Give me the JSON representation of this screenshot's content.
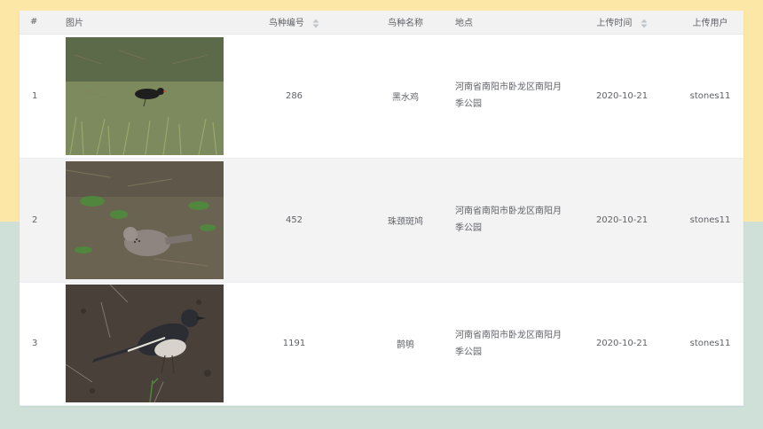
{
  "table": {
    "headers": {
      "index": "#",
      "image": "图片",
      "species_id": "鸟种编号",
      "species_name": "鸟种名称",
      "location": "地点",
      "upload_time": "上传时间",
      "upload_user": "上传用户"
    },
    "sortable_icon": "sort-caret-icon",
    "rows": [
      {
        "index": "1",
        "image_desc": "black-bird-in-grass",
        "species_id": "286",
        "species_name": "黑水鸡",
        "location": "河南省南阳市卧龙区南阳月季公园",
        "upload_time": "2020-10-21",
        "upload_user": "stones11"
      },
      {
        "index": "2",
        "image_desc": "dove-on-ground",
        "species_id": "452",
        "species_name": "珠颈斑鸠",
        "location": "河南省南阳市卧龙区南阳月季公园",
        "upload_time": "2020-10-21",
        "upload_user": "stones11"
      },
      {
        "index": "3",
        "image_desc": "magpie-robin-on-soil",
        "species_id": "1191",
        "species_name": "鹊鸲",
        "location": "河南省南阳市卧龙区南阳月季公园",
        "upload_time": "2020-10-21",
        "upload_user": "stones11"
      }
    ]
  },
  "colors": {
    "bg_top": "#fde7a6",
    "bg_bottom": "#cfe0d9",
    "header_bg": "#f2f2f2",
    "striped_row": "#f3f3f3",
    "text": "#606266"
  }
}
